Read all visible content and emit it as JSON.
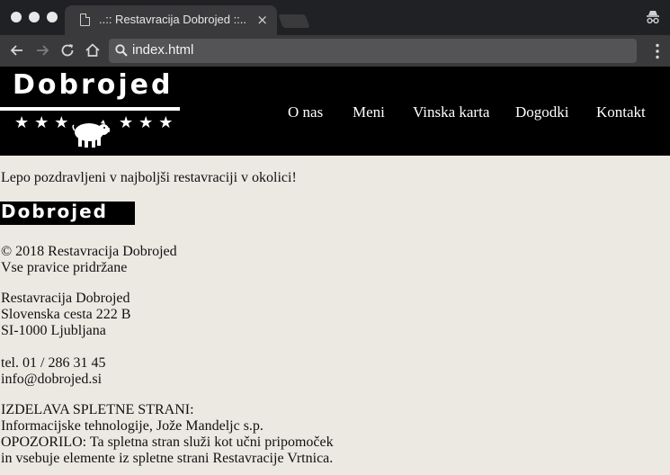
{
  "browser": {
    "tab_title": "..:: Restavracija Dobrojed ::..",
    "tab_close": "×",
    "url": "index.html"
  },
  "header": {
    "logo_text": "Dobrojed",
    "stars_left": "★★★",
    "stars_right": "★★★",
    "nav": [
      "O nas",
      "Meni",
      "Vinska karta",
      "Dogodki",
      "Kontakt"
    ]
  },
  "main": {
    "greeting": "Lepo pozdravljeni v najboljši restavraciji v okolici!",
    "footer_logo_text": "Dobrojed",
    "copyright": "© 2018 Restavracija Dobrojed",
    "rights": "Vse pravice pridržane",
    "address": [
      "Restavracija Dobrojed",
      "Slovenska cesta 222 B",
      "SI-1000 Ljubljana"
    ],
    "phone": "tel. 01 / 286 31 45",
    "email": "info@dobrojed.si",
    "credits": [
      "IZDELAVA SPLETNE STRANI:",
      "Informacijske tehnologije, Jože Mandeljc s.p.",
      "OPOZORILO: Ta spletna stran služi kot učni pripomoček",
      "in vsebuje elemente iz spletne strani Restavracije Vrtnica."
    ]
  },
  "colors": {
    "chrome_dark": "#202124",
    "chrome_toolbar": "#3a3a3c",
    "header_bg": "#000000",
    "page_bg": "#ece9e2"
  }
}
